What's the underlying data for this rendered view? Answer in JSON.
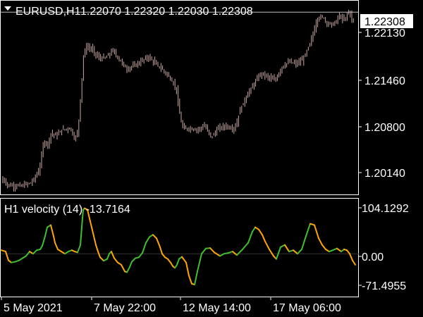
{
  "symbol_header": {
    "symbol": "EURUSD,H1",
    "ohlc": "1.22070 1.22320 1.22030 1.22308"
  },
  "price_pane": {
    "current_price_label": "1.22308",
    "axis_labels": [
      "1.22130",
      "1.21460",
      "1.20800",
      "1.20140"
    ]
  },
  "indicator_pane": {
    "title": "H1 velocity (14) -13.7164",
    "axis_labels": [
      "104.1292",
      "0.00",
      "-71.4955"
    ]
  },
  "time_axis": {
    "labels": [
      "5 May 2021",
      "7 May 22:00",
      "12 May 14:00",
      "17 May 06:00"
    ]
  },
  "colors": {
    "background": "#000000",
    "frame": "#ffffff",
    "candle": "#c8a7a2",
    "price_line": "#c0c0c0",
    "velocity_rising": "#3fbf2f",
    "velocity_falling": "#ffa500"
  },
  "chart_data": [
    {
      "type": "candlestick",
      "title": "EURUSD,H1",
      "ylim": [
        1.199,
        1.2245
      ],
      "close_path_x": [
        0,
        4,
        10,
        20,
        25,
        30,
        45,
        56,
        60,
        62,
        68,
        72,
        80,
        88,
        100,
        106,
        110,
        112,
        116,
        118,
        122,
        130,
        140,
        150,
        160,
        170,
        180,
        190,
        200,
        210,
        220,
        230,
        240,
        250,
        254,
        258,
        262,
        266,
        280,
        290,
        300,
        310,
        320,
        330,
        335,
        340,
        350,
        360,
        370,
        380,
        390,
        400,
        410,
        420,
        430,
        440,
        445,
        450,
        458,
        465,
        475,
        480,
        488,
        495,
        500,
        504
      ],
      "close_path_y": [
        1.2,
        1.201,
        1.2002,
        1.2,
        1.2001,
        1.2,
        1.2005,
        1.2022,
        1.2047,
        1.206,
        1.2055,
        1.207,
        1.2067,
        1.2075,
        1.2077,
        1.2062,
        1.2072,
        1.209,
        1.214,
        1.217,
        1.2185,
        1.2182,
        1.217,
        1.217,
        1.218,
        1.2167,
        1.2155,
        1.216,
        1.2165,
        1.2172,
        1.2163,
        1.2155,
        1.2145,
        1.213,
        1.21,
        1.208,
        1.2075,
        1.2077,
        1.2075,
        1.208,
        1.2065,
        1.2077,
        1.208,
        1.2076,
        1.208,
        1.21,
        1.212,
        1.2135,
        1.215,
        1.2145,
        1.214,
        1.2158,
        1.2165,
        1.2162,
        1.2168,
        1.219,
        1.2205,
        1.2222,
        1.2225,
        1.2215,
        1.2215,
        1.2226,
        1.222,
        1.2233,
        1.2218,
        1.2231
      ],
      "price_line": 1.22308,
      "note": ""
    },
    {
      "type": "line",
      "title": "H1 velocity (14) -13.7164",
      "ylim": [
        -71.4955,
        104.1292
      ],
      "x": [
        0,
        6,
        10,
        14,
        20,
        25,
        30,
        35,
        40,
        45,
        50,
        55,
        58,
        62,
        65,
        70,
        74,
        76,
        80,
        85,
        90,
        95,
        100,
        104,
        108,
        112,
        114,
        116,
        118,
        122,
        125,
        128,
        131,
        134,
        137,
        140,
        145,
        150,
        153,
        156,
        160,
        165,
        170,
        175,
        178,
        182,
        185,
        190,
        195,
        200,
        205,
        210,
        215,
        220,
        225,
        228,
        232,
        236,
        240,
        243,
        246,
        249,
        252,
        256,
        262,
        266,
        270,
        274,
        278,
        284,
        290,
        296,
        302,
        310,
        316,
        322,
        328,
        334,
        342,
        350,
        356,
        360,
        365,
        370,
        374,
        380,
        386,
        390,
        396,
        402,
        408,
        414,
        420,
        426,
        432,
        438,
        444,
        450,
        455,
        460,
        465,
        470,
        476,
        482,
        486,
        490,
        494,
        498,
        502
      ],
      "y": [
        8,
        5,
        -15,
        -20,
        -18,
        -15,
        -10,
        -5,
        5,
        0,
        8,
        10,
        18,
        40,
        60,
        65,
        40,
        25,
        10,
        5,
        0,
        5,
        8,
        5,
        3,
        20,
        60,
        100,
        103,
        100,
        80,
        60,
        40,
        20,
        5,
        -8,
        -16,
        -12,
        0,
        5,
        -10,
        -20,
        -25,
        -40,
        -42,
        -30,
        -18,
        -10,
        -8,
        2,
        25,
        38,
        43,
        35,
        15,
        0,
        -8,
        -12,
        -20,
        -28,
        -32,
        -25,
        -12,
        -7,
        -20,
        -50,
        -68,
        -70,
        -40,
        0,
        12,
        13,
        3,
        -5,
        0,
        2,
        5,
        -3,
        10,
        25,
        50,
        60,
        55,
        43,
        28,
        10,
        -5,
        -12,
        15,
        20,
        5,
        8,
        0,
        10,
        40,
        68,
        65,
        35,
        20,
        10,
        5,
        8,
        12,
        5,
        10,
        8,
        0,
        -15,
        -25
      ],
      "zero_line": 0
    }
  ]
}
